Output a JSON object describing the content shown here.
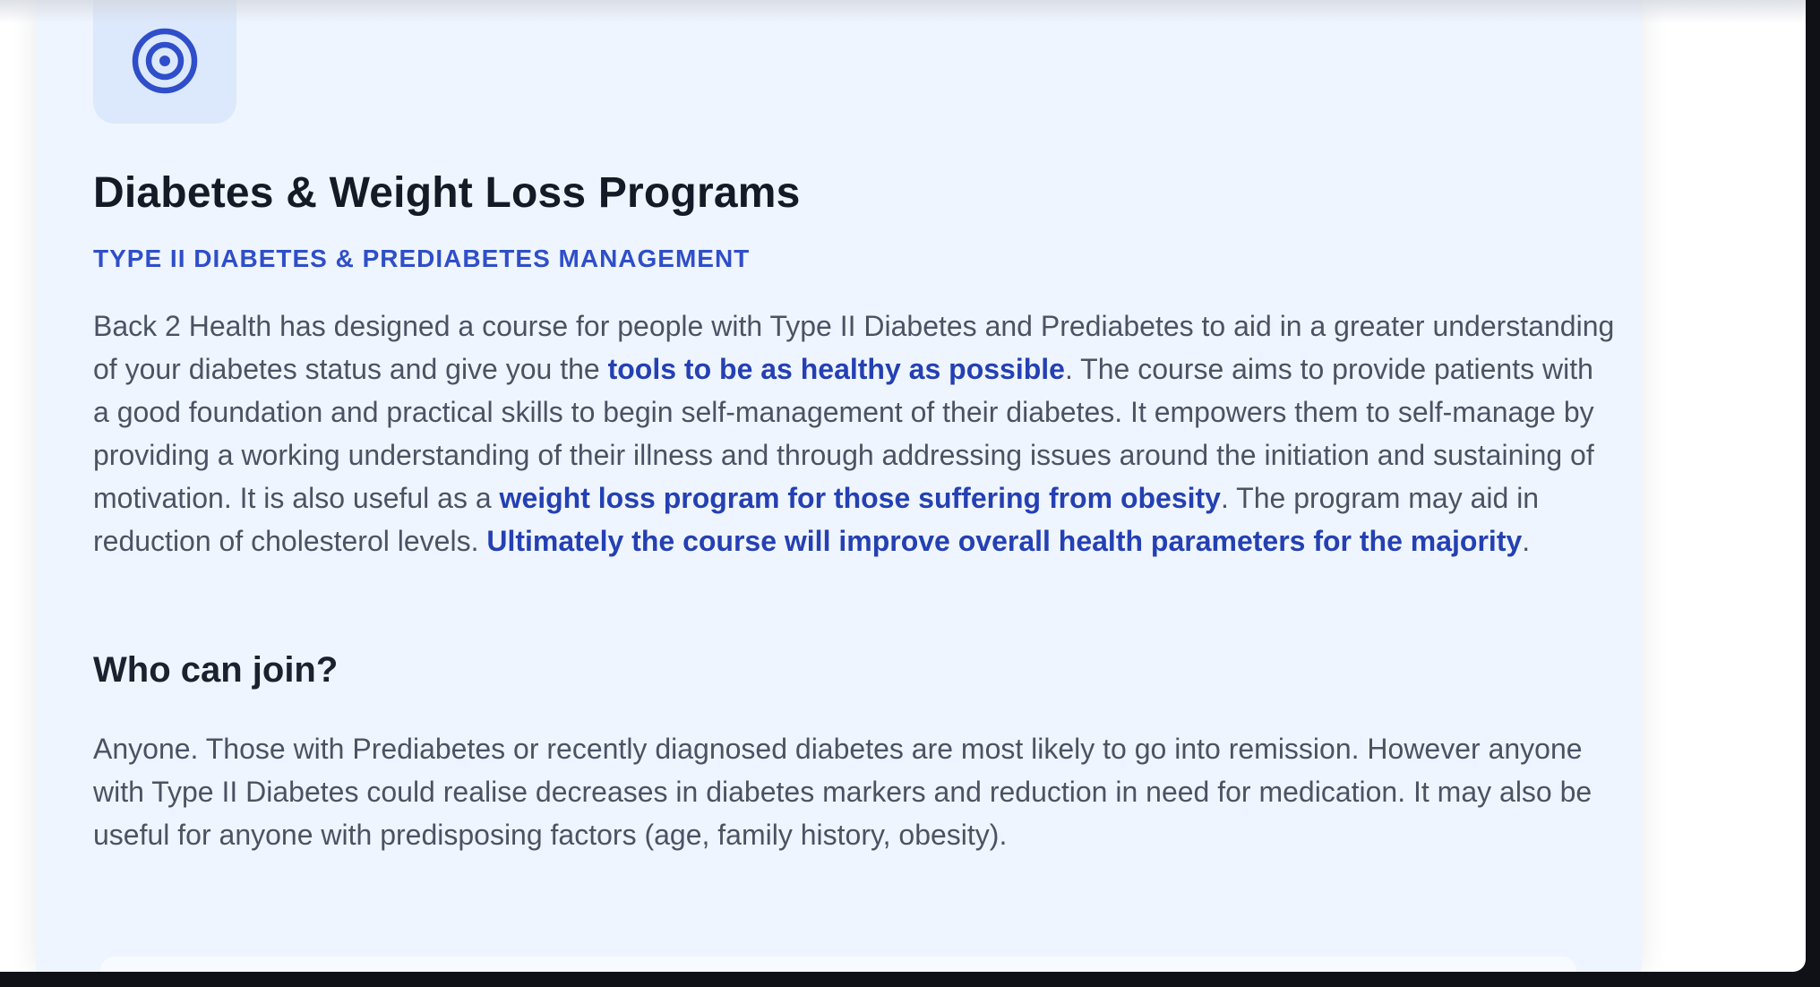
{
  "program": {
    "icon": "target-icon",
    "title": "Diabetes & Weight Loss Programs",
    "subtitle": "TYPE II DIABETES & PREDIABETES MANAGEMENT",
    "intro": {
      "t1": "Back 2 Health has designed a course for people with Type II Diabetes and Prediabetes to aid in a greater understanding of your diabetes status and give you the ",
      "b1": "tools to be as healthy as possible",
      "t2": ". The course aims to provide patients with a good foundation and practical skills to begin self-management of their diabetes. It empowers them to self-manage by providing a working understanding of their illness and through addressing issues around the initiation and sustaining of motivation. It is also useful as a ",
      "b2": "weight loss program for those suffering from obesity",
      "t3": ". The program may aid in reduction of cholesterol levels. ",
      "b3": "Ultimately the course will improve overall health parameters for the majority",
      "t4": "."
    },
    "who_heading": "Who can join?",
    "who_text": "Anyone. Those with Prediabetes or recently diagnosed diabetes are most likely to go into remission. However anyone with Type II Diabetes could realise decreases in diabetes markers and reduction in need for medication. It may also be useful for anyone with predisposing factors (age, family history, obesity)."
  },
  "colors": {
    "accent": "#2f4ec9",
    "accent_strong": "#2440b3",
    "card_bg": "#eff5ff",
    "icon_bg": "#dce8fc",
    "heading": "#141a26",
    "body_text": "#4b5363"
  }
}
